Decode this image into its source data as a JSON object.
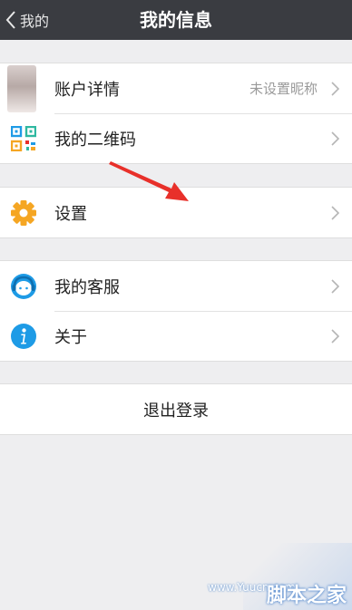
{
  "header": {
    "back_label": "我的",
    "title": "我的信息"
  },
  "group1": {
    "items": [
      {
        "label": "账户详情",
        "value": "未设置昵称",
        "icon": "avatar-icon"
      },
      {
        "label": "我的二维码",
        "icon": "qr-code-icon"
      }
    ]
  },
  "group2": {
    "items": [
      {
        "label": "设置",
        "icon": "gear-icon"
      }
    ]
  },
  "group3": {
    "items": [
      {
        "label": "我的客服",
        "icon": "customer-service-icon"
      },
      {
        "label": "关于",
        "icon": "info-icon"
      }
    ]
  },
  "logout": {
    "label": "退出登录"
  },
  "watermark": {
    "url": "www.Yuucn.com",
    "brand": "脚本之家"
  },
  "colors": {
    "header_bg": "#3a3c41",
    "page_bg": "#eeeef0",
    "gear": "#f5a623",
    "accent_blue": "#1e9be6",
    "annotation_arrow": "#e8302a"
  }
}
